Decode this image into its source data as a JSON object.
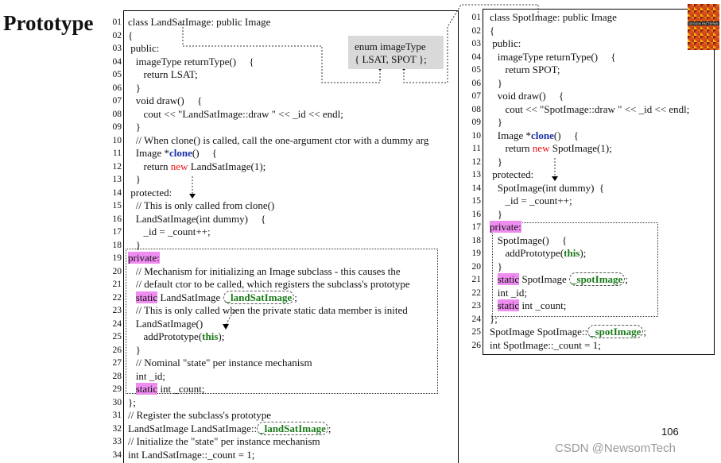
{
  "title": "Prototype",
  "logo_text": "DESIGN PATTERNS",
  "enum_box": {
    "line1": "enum imageType",
    "line2": "{ LSAT, SPOT  };"
  },
  "left": {
    "lines": [
      {
        "n": "01",
        "t": "class LandSatImage: public Image"
      },
      {
        "n": "02",
        "t": "{"
      },
      {
        "n": "03",
        "t": " public:"
      },
      {
        "n": "04",
        "t": "   imageType returnType()     {"
      },
      {
        "n": "05",
        "t": "      return LSAT;"
      },
      {
        "n": "06",
        "t": "   }"
      },
      {
        "n": "07",
        "t": "   void draw()     {"
      },
      {
        "n": "08",
        "t": "      cout << \"LandSatImage::draw \" << _id << endl;"
      },
      {
        "n": "09",
        "t": "   }"
      },
      {
        "n": "10",
        "t": "   // When clone() is called, call the one-argument ctor with a dummy arg"
      },
      {
        "n": "11",
        "t": "   Image *",
        "b": "clone",
        "t2": "()     {"
      },
      {
        "n": "12",
        "t": "      return ",
        "r": "new",
        "t2": " LandSatImage(1);"
      },
      {
        "n": "13",
        "t": "   }"
      },
      {
        "n": "14",
        "t": " protected:"
      },
      {
        "n": "15",
        "t": "   // This is only called from clone()"
      },
      {
        "n": "16",
        "t": "   LandSatImage(int dummy)     {"
      },
      {
        "n": "17",
        "t": "      _id = _count++;"
      },
      {
        "n": "18",
        "t": "   }"
      },
      {
        "n": "19",
        "p": "private:"
      },
      {
        "n": "20",
        "t": "   // Mechanism for initializing an Image subclass - this causes the"
      },
      {
        "n": "21",
        "t": "   // default ctor to be called, which registers the subclass's prototype"
      },
      {
        "n": "22",
        "t": "   ",
        "p": "static",
        "t2": " LandSatImage ",
        "g": "_landSatImage",
        "t3": ";"
      },
      {
        "n": "23",
        "t": "   // This is only called when the private static data member is inited"
      },
      {
        "n": "24",
        "t": "   LandSatImage()"
      },
      {
        "n": "25",
        "t": "      addPrototype(",
        "g2": "this",
        "t2": ");"
      },
      {
        "n": "26",
        "t": "   }"
      },
      {
        "n": "27",
        "t": "   // Nominal \"state\" per instance mechanism"
      },
      {
        "n": "28",
        "t": "   int _id;"
      },
      {
        "n": "29",
        "t": "   ",
        "p": "static",
        "t2": " int _count;"
      },
      {
        "n": "30",
        "t": "};"
      },
      {
        "n": "31",
        "t": "// Register the subclass's prototype"
      },
      {
        "n": "32",
        "t": "LandSatImage LandSatImage::",
        "g": "_landSatImage",
        "t3": ";"
      },
      {
        "n": "33",
        "t": "// Initialize the \"state\" per instance mechanism"
      },
      {
        "n": "34",
        "t": "int LandSatImage::_count = 1;"
      }
    ]
  },
  "right": {
    "lines": [
      {
        "n": "01",
        "t": "class SpotImage: public Image"
      },
      {
        "n": "02",
        "t": "{"
      },
      {
        "n": "03",
        "t": " public:"
      },
      {
        "n": "04",
        "t": "   imageType returnType()     {"
      },
      {
        "n": "05",
        "t": "      return SPOT;"
      },
      {
        "n": "06",
        "t": "   }"
      },
      {
        "n": "07",
        "t": "   void draw()     {"
      },
      {
        "n": "08",
        "t": "      cout << \"SpotImage::draw \" << _id << endl;"
      },
      {
        "n": "09",
        "t": "   }"
      },
      {
        "n": "10",
        "t": "   Image *",
        "b": "clone",
        "t2": "()     {"
      },
      {
        "n": "11",
        "t": "      return ",
        "r": "new",
        "t2": " SpotImage(1);"
      },
      {
        "n": "12",
        "t": "   }"
      },
      {
        "n": "13",
        "t": " protected:"
      },
      {
        "n": "14",
        "t": "   SpotImage(int dummy)  {"
      },
      {
        "n": "15",
        "t": "      _id = _count++;"
      },
      {
        "n": "16",
        "t": "   }"
      },
      {
        "n": "17",
        "p": "private:"
      },
      {
        "n": "18",
        "t": "   SpotImage()     {"
      },
      {
        "n": "19",
        "t": "      addPrototype(",
        "g2": "this",
        "t2": ");"
      },
      {
        "n": "20",
        "t": "   }"
      },
      {
        "n": "21",
        "t": "   ",
        "p": "static",
        "t2": " SpotImage ",
        "g": "_spotImage",
        "t3": ";"
      },
      {
        "n": "22",
        "t": "   int _id;"
      },
      {
        "n": "23",
        "t": "   ",
        "p": "static",
        "t2": " int _count;"
      },
      {
        "n": "24",
        "t": "};"
      },
      {
        "n": "25",
        "t": "SpotImage SpotImage::",
        "g": "_spotImage",
        "t3": ";"
      },
      {
        "n": "26",
        "t": "int SpotImage::_count = 1;"
      }
    ]
  },
  "page_number": "106",
  "watermark": "CSDN @NewsomTech"
}
